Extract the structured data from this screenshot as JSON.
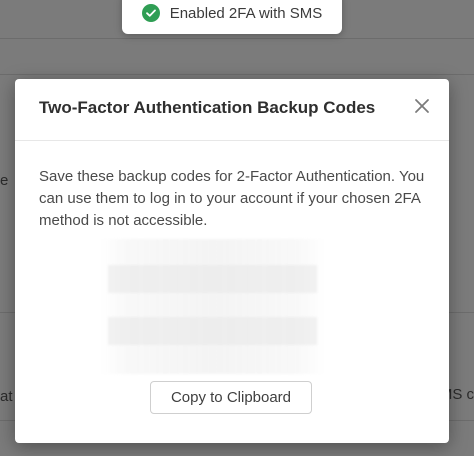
{
  "toast": {
    "message": "Enabled 2FA with SMS",
    "icon": "check-circle-icon",
    "accent": "#2f9e54"
  },
  "background": {
    "fragments": {
      "left_top": "e",
      "left_bottom": "at",
      "right_bottom": "MS c"
    }
  },
  "modal": {
    "title": "Two-Factor Authentication Backup Codes",
    "close_icon": "close-icon",
    "description": "Save these backup codes for 2-Factor Authentication. You can use them to log in to your account if your chosen 2FA method is not accessible.",
    "copy_button_label": "Copy to Clipboard"
  }
}
